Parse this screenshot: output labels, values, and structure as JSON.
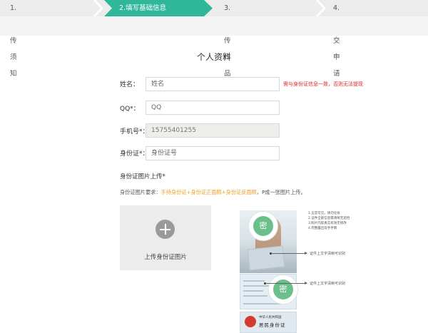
{
  "steps": [
    {
      "label": "1.上传须知"
    },
    {
      "label": "2.填写基础信息"
    },
    {
      "label": "3.上传作品"
    },
    {
      "label": "4.提交申请"
    }
  ],
  "colors": {
    "active_step": "#2fb79a",
    "warning_red": "#e02424",
    "highlight_orange": "#f0a020"
  },
  "form": {
    "title": "个人资料",
    "name": {
      "label": "姓名：",
      "placeholder": "姓名",
      "hint": "需与身份证信息一致，否则无法提现"
    },
    "qq": {
      "label": "QQ*：",
      "placeholder": "QQ"
    },
    "phone": {
      "label": "手机号*：",
      "value": "15755401255"
    },
    "idcard": {
      "label": "身份证*：",
      "placeholder": "身份证号"
    }
  },
  "upload": {
    "title": "身份证图片上传*",
    "req_prefix": "身份证图片要求：",
    "req_highlight": "手持身份证+身份证正面照+身份证反面照",
    "req_suffix": "，P成一张图片上传。",
    "button_label": "上传身份证图片",
    "plus_icon": "plus-circle-icon"
  },
  "sample": {
    "watermark": "密",
    "notes": [
      "1.五官可见，请勿化妆",
      "2.证件全部信息需清晰无遮挡",
      "3.照片内容真实有效无修改",
      "4.完整露出双手手臂"
    ],
    "callout1": "证件上文字清晰可识别",
    "callout2": "证件上文字清晰可识别",
    "card_line1": "中华人民共和国",
    "card_line2": "居民身份证"
  }
}
